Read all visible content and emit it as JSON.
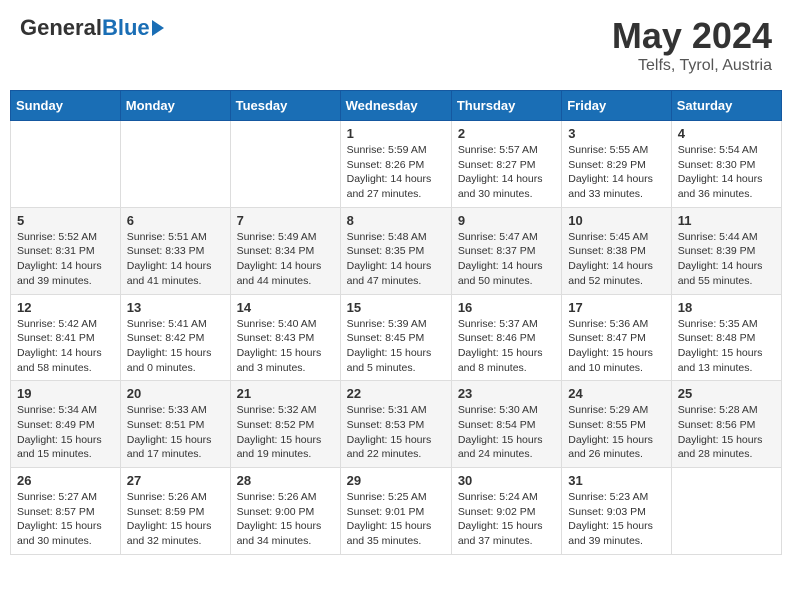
{
  "header": {
    "logo_general": "General",
    "logo_blue": "Blue",
    "month_title": "May 2024",
    "location": "Telfs, Tyrol, Austria"
  },
  "days_of_week": [
    "Sunday",
    "Monday",
    "Tuesday",
    "Wednesday",
    "Thursday",
    "Friday",
    "Saturday"
  ],
  "weeks": [
    [
      {
        "day": "",
        "info": ""
      },
      {
        "day": "",
        "info": ""
      },
      {
        "day": "",
        "info": ""
      },
      {
        "day": "1",
        "info": "Sunrise: 5:59 AM\nSunset: 8:26 PM\nDaylight: 14 hours and 27 minutes."
      },
      {
        "day": "2",
        "info": "Sunrise: 5:57 AM\nSunset: 8:27 PM\nDaylight: 14 hours and 30 minutes."
      },
      {
        "day": "3",
        "info": "Sunrise: 5:55 AM\nSunset: 8:29 PM\nDaylight: 14 hours and 33 minutes."
      },
      {
        "day": "4",
        "info": "Sunrise: 5:54 AM\nSunset: 8:30 PM\nDaylight: 14 hours and 36 minutes."
      }
    ],
    [
      {
        "day": "5",
        "info": "Sunrise: 5:52 AM\nSunset: 8:31 PM\nDaylight: 14 hours and 39 minutes."
      },
      {
        "day": "6",
        "info": "Sunrise: 5:51 AM\nSunset: 8:33 PM\nDaylight: 14 hours and 41 minutes."
      },
      {
        "day": "7",
        "info": "Sunrise: 5:49 AM\nSunset: 8:34 PM\nDaylight: 14 hours and 44 minutes."
      },
      {
        "day": "8",
        "info": "Sunrise: 5:48 AM\nSunset: 8:35 PM\nDaylight: 14 hours and 47 minutes."
      },
      {
        "day": "9",
        "info": "Sunrise: 5:47 AM\nSunset: 8:37 PM\nDaylight: 14 hours and 50 minutes."
      },
      {
        "day": "10",
        "info": "Sunrise: 5:45 AM\nSunset: 8:38 PM\nDaylight: 14 hours and 52 minutes."
      },
      {
        "day": "11",
        "info": "Sunrise: 5:44 AM\nSunset: 8:39 PM\nDaylight: 14 hours and 55 minutes."
      }
    ],
    [
      {
        "day": "12",
        "info": "Sunrise: 5:42 AM\nSunset: 8:41 PM\nDaylight: 14 hours and 58 minutes."
      },
      {
        "day": "13",
        "info": "Sunrise: 5:41 AM\nSunset: 8:42 PM\nDaylight: 15 hours and 0 minutes."
      },
      {
        "day": "14",
        "info": "Sunrise: 5:40 AM\nSunset: 8:43 PM\nDaylight: 15 hours and 3 minutes."
      },
      {
        "day": "15",
        "info": "Sunrise: 5:39 AM\nSunset: 8:45 PM\nDaylight: 15 hours and 5 minutes."
      },
      {
        "day": "16",
        "info": "Sunrise: 5:37 AM\nSunset: 8:46 PM\nDaylight: 15 hours and 8 minutes."
      },
      {
        "day": "17",
        "info": "Sunrise: 5:36 AM\nSunset: 8:47 PM\nDaylight: 15 hours and 10 minutes."
      },
      {
        "day": "18",
        "info": "Sunrise: 5:35 AM\nSunset: 8:48 PM\nDaylight: 15 hours and 13 minutes."
      }
    ],
    [
      {
        "day": "19",
        "info": "Sunrise: 5:34 AM\nSunset: 8:49 PM\nDaylight: 15 hours and 15 minutes."
      },
      {
        "day": "20",
        "info": "Sunrise: 5:33 AM\nSunset: 8:51 PM\nDaylight: 15 hours and 17 minutes."
      },
      {
        "day": "21",
        "info": "Sunrise: 5:32 AM\nSunset: 8:52 PM\nDaylight: 15 hours and 19 minutes."
      },
      {
        "day": "22",
        "info": "Sunrise: 5:31 AM\nSunset: 8:53 PM\nDaylight: 15 hours and 22 minutes."
      },
      {
        "day": "23",
        "info": "Sunrise: 5:30 AM\nSunset: 8:54 PM\nDaylight: 15 hours and 24 minutes."
      },
      {
        "day": "24",
        "info": "Sunrise: 5:29 AM\nSunset: 8:55 PM\nDaylight: 15 hours and 26 minutes."
      },
      {
        "day": "25",
        "info": "Sunrise: 5:28 AM\nSunset: 8:56 PM\nDaylight: 15 hours and 28 minutes."
      }
    ],
    [
      {
        "day": "26",
        "info": "Sunrise: 5:27 AM\nSunset: 8:57 PM\nDaylight: 15 hours and 30 minutes."
      },
      {
        "day": "27",
        "info": "Sunrise: 5:26 AM\nSunset: 8:59 PM\nDaylight: 15 hours and 32 minutes."
      },
      {
        "day": "28",
        "info": "Sunrise: 5:26 AM\nSunset: 9:00 PM\nDaylight: 15 hours and 34 minutes."
      },
      {
        "day": "29",
        "info": "Sunrise: 5:25 AM\nSunset: 9:01 PM\nDaylight: 15 hours and 35 minutes."
      },
      {
        "day": "30",
        "info": "Sunrise: 5:24 AM\nSunset: 9:02 PM\nDaylight: 15 hours and 37 minutes."
      },
      {
        "day": "31",
        "info": "Sunrise: 5:23 AM\nSunset: 9:03 PM\nDaylight: 15 hours and 39 minutes."
      },
      {
        "day": "",
        "info": ""
      }
    ]
  ]
}
